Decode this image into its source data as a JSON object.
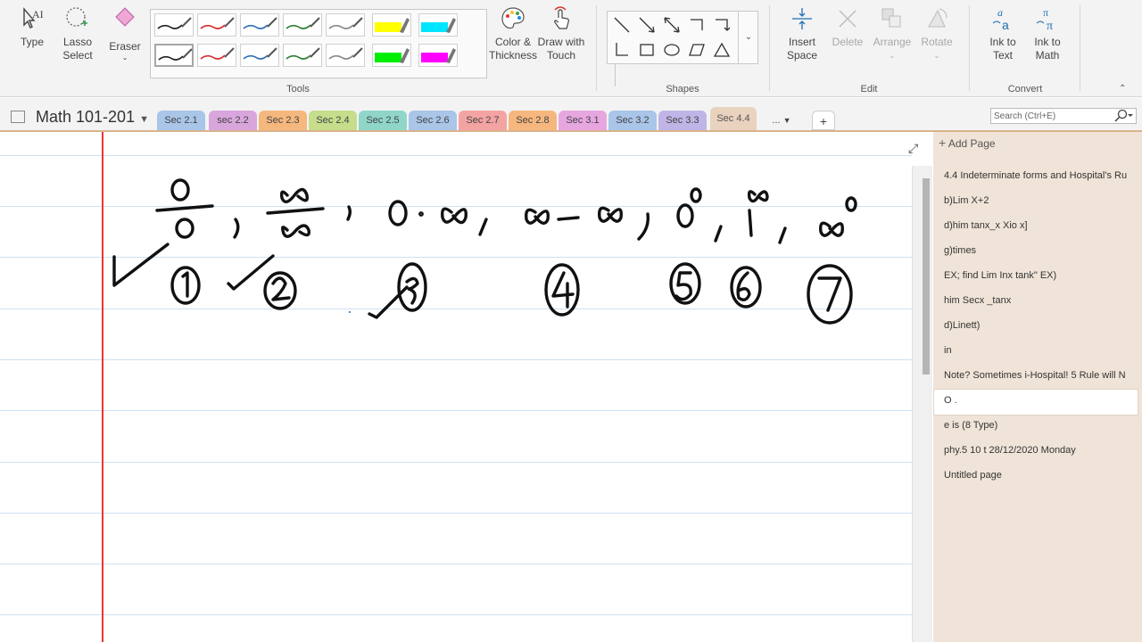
{
  "ribbon": {
    "type_label": "Type",
    "lasso_label_1": "Lasso",
    "lasso_label_2": "Select",
    "eraser_label": "Eraser",
    "color_label_1": "Color &",
    "color_label_2": "Thickness",
    "draw_touch_1": "Draw with",
    "draw_touch_2": "Touch",
    "insert_space_1": "Insert",
    "insert_space_2": "Space",
    "delete_label": "Delete",
    "arrange_label": "Arrange",
    "rotate_label": "Rotate",
    "ink_text_1": "Ink to",
    "ink_text_2": "Text",
    "ink_math_1": "Ink to",
    "ink_math_2": "Math",
    "groups": {
      "tools": "Tools",
      "shapes": "Shapes",
      "edit": "Edit",
      "convert": "Convert"
    },
    "pen_colors": [
      "#222222",
      "#d32f2f",
      "#2f6fb6",
      "#2e7d32",
      "#888888",
      "#ffff00",
      "#00e5ff",
      "#222222",
      "#d32f2f",
      "#2f6fb6",
      "#2e7d32",
      "#888888",
      "#00ee00",
      "#ff00ff"
    ]
  },
  "notebook": {
    "name": "Math 101-201"
  },
  "tabs": [
    {
      "label": "Sec 2.1",
      "color": "#a9c5e8"
    },
    {
      "label": "sec 2.2",
      "color": "#d8a6dc"
    },
    {
      "label": "Sec 2.3",
      "color": "#f5b77e"
    },
    {
      "label": "Sec 2.4",
      "color": "#c6dd8c"
    },
    {
      "label": "Sec 2.5",
      "color": "#8fd6c9"
    },
    {
      "label": "Sec 2.6",
      "color": "#a9c5e8"
    },
    {
      "label": "Sec 2.7",
      "color": "#f4a3a3"
    },
    {
      "label": "Sec 2.8",
      "color": "#f5b77e"
    },
    {
      "label": "Sec 3.1",
      "color": "#e7a6e0"
    },
    {
      "label": "Sec 3.2",
      "color": "#a9c5e8"
    },
    {
      "label": "Sec 3.3",
      "color": "#c0b5e6"
    },
    {
      "label": "Sec 4.4",
      "color": "#e9d3bf"
    }
  ],
  "more_tabs": "...",
  "add_tab": "+",
  "search": {
    "placeholder": "Search (Ctrl+E)"
  },
  "pages_panel": {
    "add_page": "Add Page",
    "pages": [
      "4.4 Indeterminate forms and Hospital's Ru",
      "b)Lim X+2",
      "d)him tanx_x  Xio x]",
      "g)times",
      "EX; find Lim Inx tank\" EX)",
      "him Secx _tanx",
      "d)Linett)",
      "in",
      "Note? Sometimes i-Hospital! 5 Rule will N",
      "O .",
      "e is (8 Type)",
      "phy.5 10 t 28/12/2020 Monday",
      "Untitled page"
    ],
    "selected_index": 9
  },
  "colors": {
    "ribbon_bg": "#f3f3f3",
    "panel_bg": "#f0e4d8",
    "margin": "#e53935",
    "rule": "#cfe0f2"
  }
}
